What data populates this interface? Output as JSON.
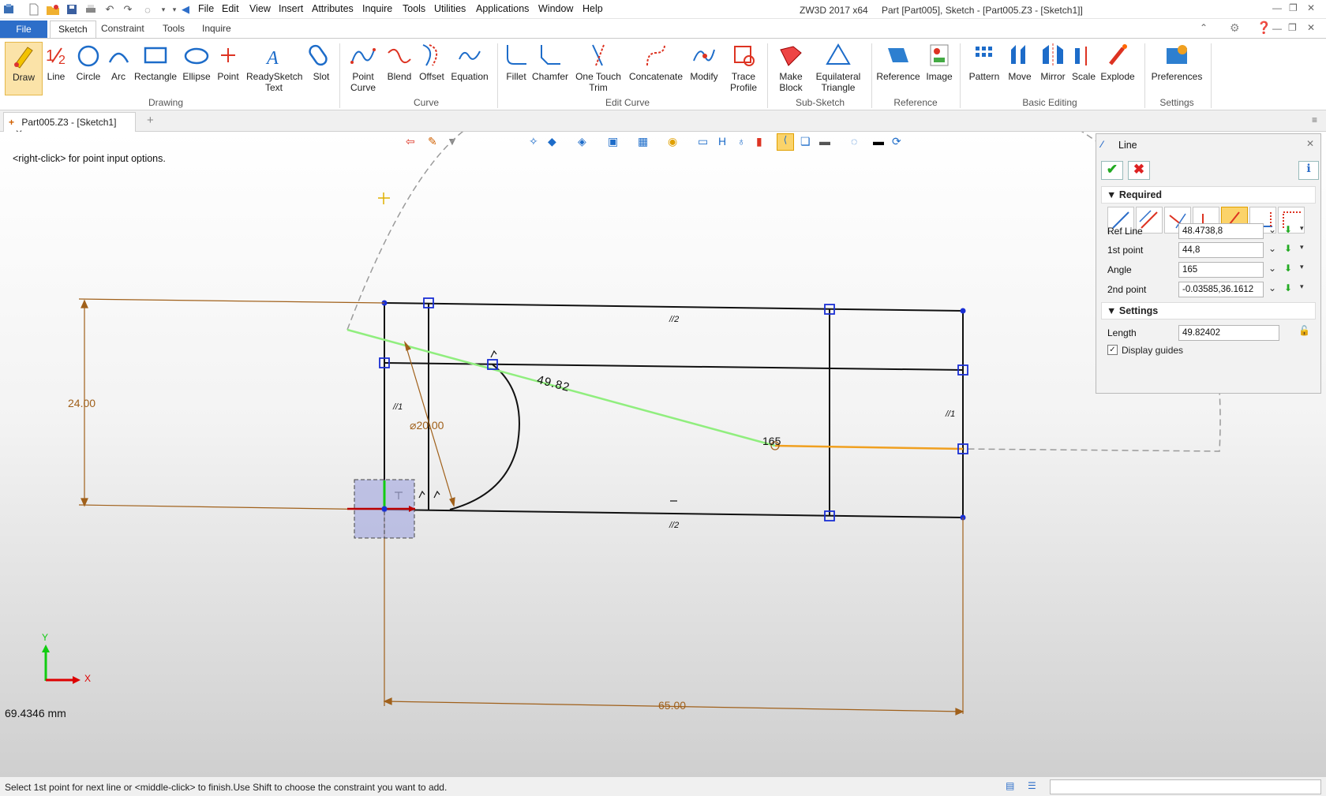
{
  "titlebar": {
    "menu": [
      "File",
      "Edit",
      "View",
      "Insert",
      "Attributes",
      "Inquire",
      "Tools",
      "Utilities",
      "Applications",
      "Window",
      "Help"
    ],
    "app_name": "ZW3D 2017  x64",
    "document": "Part [Part005],  Sketch - [Part005.Z3 - [Sketch1]]"
  },
  "ribbon_tabs": {
    "file": "File",
    "tabs": [
      "Sketch",
      "Constraint",
      "Tools",
      "Inquire"
    ]
  },
  "ribbon": {
    "drawing": {
      "draw": "Draw",
      "line": "Line",
      "circle": "Circle",
      "arc": "Arc",
      "rectangle": "Rectangle",
      "ellipse": "Ellipse",
      "point": "Point",
      "readysketch1": "ReadySketch",
      "readysketch2": "Text",
      "slot": "Slot",
      "group": "Drawing"
    },
    "curve": {
      "pointcurve1": "Point",
      "pointcurve2": "Curve",
      "blend": "Blend",
      "offset": "Offset",
      "equation": "Equation",
      "group": "Curve"
    },
    "edit": {
      "fillet": "Fillet",
      "chamfer": "Chamfer",
      "onetouch1": "One Touch",
      "onetouch2": "Trim",
      "concatenate": "Concatenate",
      "modify": "Modify",
      "trace1": "Trace",
      "trace2": "Profile",
      "group": "Edit Curve"
    },
    "subsketch": {
      "make1": "Make",
      "make2": "Block",
      "eq1": "Equilateral",
      "eq2": "Triangle",
      "group": "Sub-Sketch"
    },
    "reference": {
      "reference": "Reference",
      "image": "Image",
      "group": "Reference"
    },
    "basic": {
      "pattern": "Pattern",
      "move": "Move",
      "mirror": "Mirror",
      "scale": "Scale",
      "explode": "Explode",
      "group": "Basic Editing"
    },
    "settings": {
      "preferences": "Preferences",
      "group": "Settings"
    }
  },
  "doc_tab": {
    "label": "Part005.Z3 - [Sketch1]"
  },
  "canvas": {
    "hint": "<right-click> for point input options.",
    "readout": "69.4346 mm",
    "dims": {
      "d24": "24.00",
      "d20": "20.00",
      "d4982": "49.82",
      "d165": "165",
      "d65": "65.00",
      "p2a": "//2",
      "p2b": "//2",
      "p1a": "//1",
      "p1b": "//1"
    },
    "axis": {
      "x": "X",
      "y": "Y"
    }
  },
  "panel": {
    "title": "Line",
    "required": "Required",
    "ref_line_label": "Ref Line",
    "ref_line_value": "48.4738,8",
    "first_point_label": "1st point",
    "first_point_value": "44,8",
    "angle_label": "Angle",
    "angle_value": "165",
    "second_point_label": "2nd point",
    "second_point_value": "-0.03585,36.1612",
    "settings": "Settings",
    "length_label": "Length",
    "length_value": "49.82402",
    "display_guides": "Display guides"
  },
  "status": {
    "message": "Select 1st point for next line or <middle-click> to finish.Use Shift to choose the constraint you want to add."
  },
  "colors": {
    "accent": "#2d6ec9",
    "guide": "#90ee7e",
    "dim": "#a0601a",
    "highlight": "#f0a020",
    "handle": "#1a2fd4"
  }
}
